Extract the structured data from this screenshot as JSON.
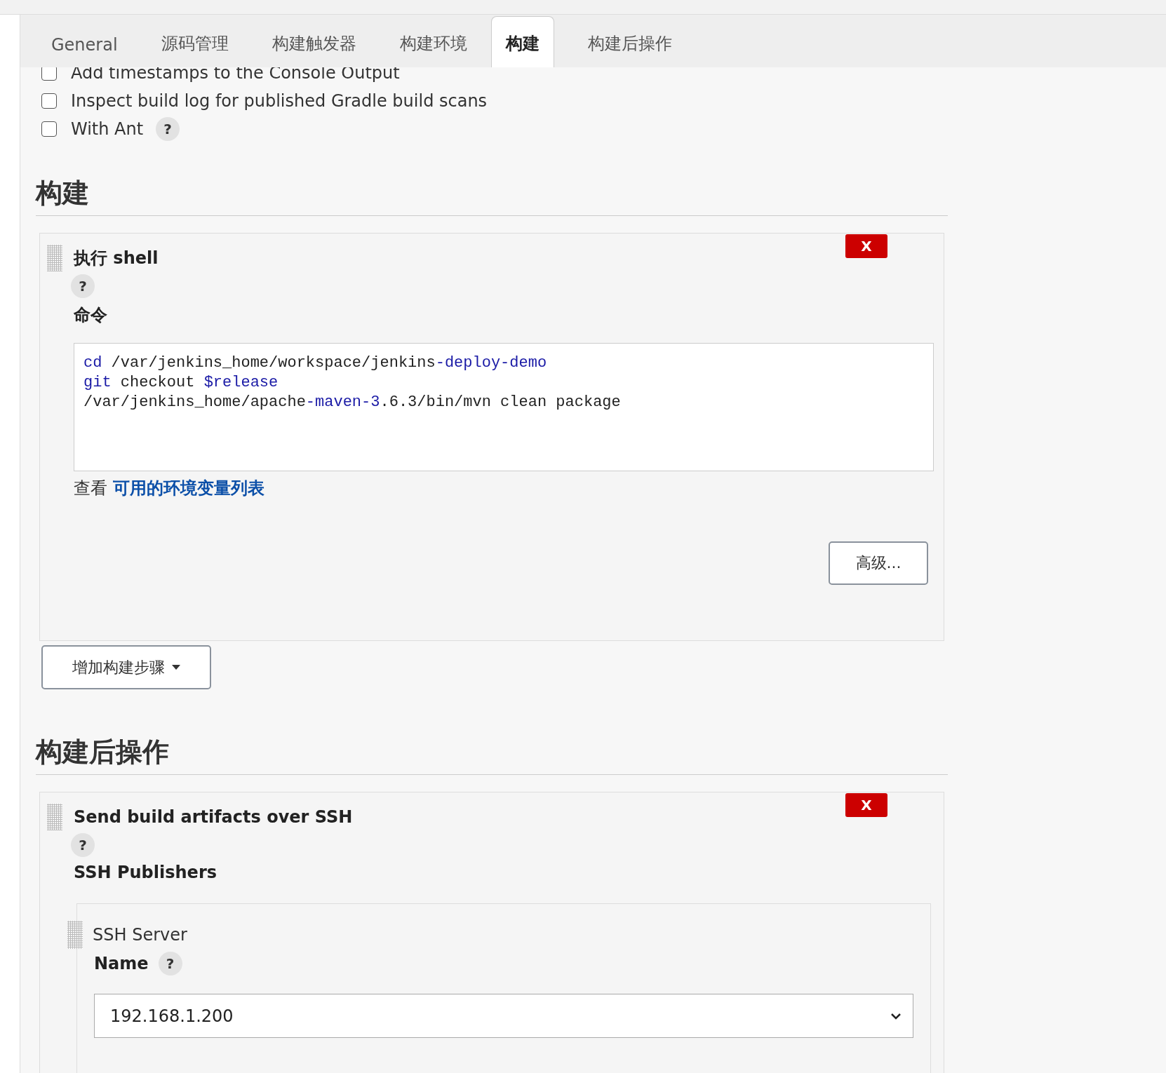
{
  "tabs": [
    {
      "label": "General",
      "selected": false
    },
    {
      "label": "源码管理",
      "selected": false
    },
    {
      "label": "构建触发器",
      "selected": false
    },
    {
      "label": "构建环境",
      "selected": false
    },
    {
      "label": "构建",
      "selected": true
    },
    {
      "label": "构建后操作",
      "selected": false
    }
  ],
  "options": [
    {
      "label": "Add timestamps to the Console Output",
      "checked": false
    },
    {
      "label": "Inspect build log for published Gradle build scans",
      "checked": false
    },
    {
      "label": "With Ant",
      "checked": false,
      "help": "?"
    }
  ],
  "build": {
    "heading": "构建",
    "step": {
      "title": "执行 shell",
      "delete": "X",
      "help": "?",
      "field_label": "命令",
      "command": [
        [
          {
            "kind": "keyword",
            "text": "cd"
          },
          {
            "kind": "text",
            "text": " /var/jenkins_home/workspace/jenkins"
          },
          {
            "kind": "keyword",
            "text": "-deploy-demo"
          }
        ],
        [
          {
            "kind": "keyword",
            "text": "git"
          },
          {
            "kind": "text",
            "text": " checkout "
          },
          {
            "kind": "keyword",
            "text": "$release"
          }
        ],
        [
          {
            "kind": "text",
            "text": "/var/jenkins_home/apache"
          },
          {
            "kind": "keyword",
            "text": "-maven-3"
          },
          {
            "kind": "text",
            "text": ".6.3/bin/mvn clean package"
          }
        ]
      ],
      "hint": "查看",
      "link": "可用的环境变量列表",
      "advanced": "高级..."
    },
    "add_step": "增加构建步骤"
  },
  "post_build": {
    "heading": "构建后操作",
    "step": {
      "title": "Send build artifacts over SSH",
      "delete": "X",
      "help": "?",
      "section": "SSH Publishers",
      "server": {
        "title": "SSH Server",
        "name_label": "Name",
        "help": "?",
        "name_value": "192.168.1.200"
      }
    }
  }
}
